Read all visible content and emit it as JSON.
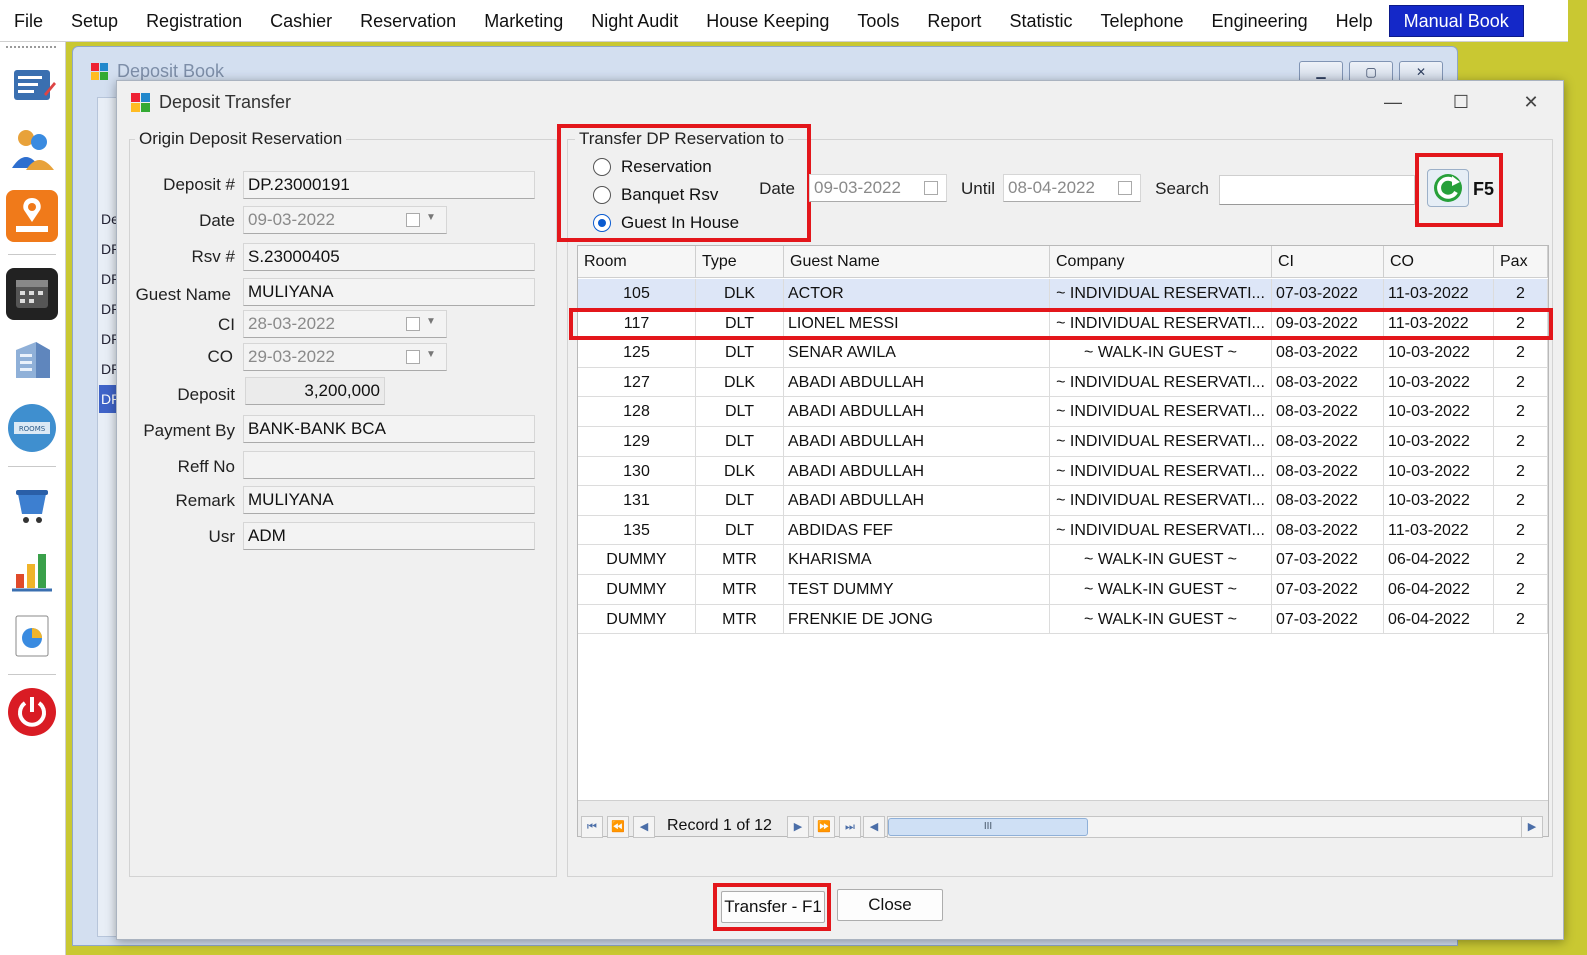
{
  "menu": [
    "File",
    "Setup",
    "Registration",
    "Cashier",
    "Reservation",
    "Marketing",
    "Night Audit",
    "House Keeping",
    "Tools",
    "Report",
    "Statistic",
    "Telephone",
    "Engineering",
    "Help",
    "Manual Book"
  ],
  "parent_window": {
    "title": "Deposit Book",
    "left_cells": [
      "De",
      "DP",
      "DP",
      "DP",
      "DP",
      "DP",
      "DP"
    ]
  },
  "dialog": {
    "title": "Deposit Transfer",
    "origin_group": "Origin Deposit Reservation",
    "fields": {
      "deposit_no_label": "Deposit #",
      "deposit_no": "DP.23000191",
      "date_label": "Date",
      "date": "09-03-2022",
      "rsv_label": "Rsv #",
      "rsv": "S.23000405",
      "guest_label": "Guest Name",
      "guest": "MULIYANA",
      "ci_label": "CI",
      "ci": "28-03-2022",
      "co_label": "CO",
      "co": "29-03-2022",
      "deposit_label": "Deposit",
      "deposit": "3,200,000",
      "payment_label": "Payment By",
      "payment": "BANK-BANK BCA",
      "reff_label": "Reff No",
      "reff": "",
      "remark_label": "Remark",
      "remark": "MULIYANA",
      "usr_label": "Usr",
      "usr": "ADM"
    },
    "transfer_group": "Transfer DP Reservation to",
    "radios": [
      {
        "label": "Reservation",
        "checked": false
      },
      {
        "label": "Banquet Rsv",
        "checked": false
      },
      {
        "label": "Guest In House",
        "checked": true
      }
    ],
    "filter": {
      "date_label": "Date",
      "date": "09-03-2022",
      "until_label": "Until",
      "until": "08-04-2022",
      "search_label": "Search",
      "search": "",
      "refresh_key": "F5"
    },
    "grid": {
      "columns": [
        "Room",
        "Type",
        "Guest Name",
        "Company",
        "CI",
        "CO",
        "Pax"
      ],
      "rows": [
        [
          "105",
          "DLK",
          "ACTOR",
          "~ INDIVIDUAL RESERVATI...",
          "07-03-2022",
          "11-03-2022",
          "2"
        ],
        [
          "117",
          "DLT",
          "LIONEL MESSI",
          "~ INDIVIDUAL RESERVATI...",
          "09-03-2022",
          "11-03-2022",
          "2"
        ],
        [
          "125",
          "DLT",
          "SENAR AWILA",
          "~ WALK-IN GUEST ~",
          "08-03-2022",
          "10-03-2022",
          "2"
        ],
        [
          "127",
          "DLK",
          "ABADI ABDULLAH",
          "~ INDIVIDUAL RESERVATI...",
          "08-03-2022",
          "10-03-2022",
          "2"
        ],
        [
          "128",
          "DLT",
          "ABADI ABDULLAH",
          "~ INDIVIDUAL RESERVATI...",
          "08-03-2022",
          "10-03-2022",
          "2"
        ],
        [
          "129",
          "DLT",
          "ABADI ABDULLAH",
          "~ INDIVIDUAL RESERVATI...",
          "08-03-2022",
          "10-03-2022",
          "2"
        ],
        [
          "130",
          "DLK",
          "ABADI ABDULLAH",
          "~ INDIVIDUAL RESERVATI...",
          "08-03-2022",
          "10-03-2022",
          "2"
        ],
        [
          "131",
          "DLT",
          "ABADI ABDULLAH",
          "~ INDIVIDUAL RESERVATI...",
          "08-03-2022",
          "10-03-2022",
          "2"
        ],
        [
          "135",
          "DLT",
          "ABDIDAS FEF",
          "~ INDIVIDUAL RESERVATI...",
          "08-03-2022",
          "11-03-2022",
          "2"
        ],
        [
          "DUMMY",
          "MTR",
          "KHARISMA",
          "~ WALK-IN GUEST ~",
          "07-03-2022",
          "06-04-2022",
          "2"
        ],
        [
          "DUMMY",
          "MTR",
          "TEST DUMMY",
          "~ WALK-IN GUEST ~",
          "07-03-2022",
          "06-04-2022",
          "2"
        ],
        [
          "DUMMY",
          "MTR",
          "FRENKIE DE JONG",
          "~ WALK-IN GUEST ~",
          "07-03-2022",
          "06-04-2022",
          "2"
        ]
      ]
    },
    "record_text": "Record 1 of 12",
    "scroll_thumb": "III",
    "buttons": {
      "transfer": "Transfer - F1",
      "close": "Close"
    }
  },
  "colors": {
    "highlight": "#e3161b",
    "active_menu": "#1428c8",
    "desktop": "#c9c832"
  }
}
